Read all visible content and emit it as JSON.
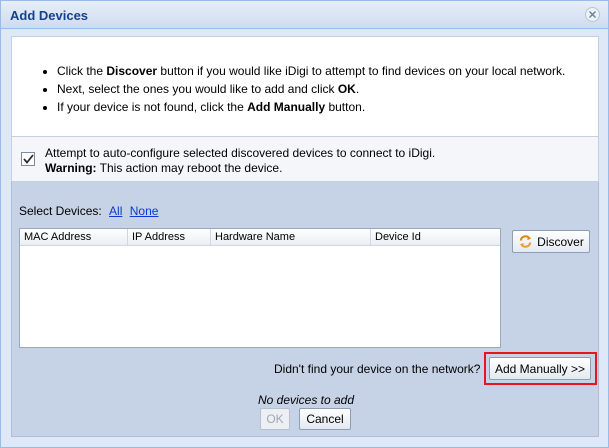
{
  "dialog": {
    "title": "Add Devices",
    "close_icon": "close-icon"
  },
  "instructions": {
    "line1": {
      "pre": "Click the ",
      "bold": "Discover",
      "post": " button if you would like iDigi to attempt to find devices on your local network."
    },
    "line2": {
      "pre": "Next, select the ones you would like to add and click ",
      "bold": "OK",
      "post": "."
    },
    "line3": {
      "pre": "If your device is not found, click the ",
      "bold": "Add Manually",
      "post": " button."
    }
  },
  "auto_configure": {
    "checked": true,
    "text": "Attempt to auto-configure selected discovered devices to connect to iDigi.",
    "warning_label": "Warning:",
    "warning_text": " This action may reboot the device."
  },
  "select_devices": {
    "label": "Select Devices:",
    "all_link": "All",
    "none_link": "None"
  },
  "grid": {
    "columns": [
      "MAC Address",
      "IP Address",
      "Hardware Name",
      "Device Id"
    ],
    "rows": []
  },
  "buttons": {
    "discover": "Discover",
    "discover_icon": "refresh-arrows-icon",
    "add_manually": "Add Manually >>",
    "ok": "OK",
    "cancel": "Cancel"
  },
  "not_found_text": "Didn't find your device on the network?",
  "status_text": "No devices to add",
  "colors": {
    "title_text": "#15428b",
    "link": "#0b3bcc",
    "panel_bg": "#c6d2e5",
    "highlight_border": "#e8141e"
  }
}
